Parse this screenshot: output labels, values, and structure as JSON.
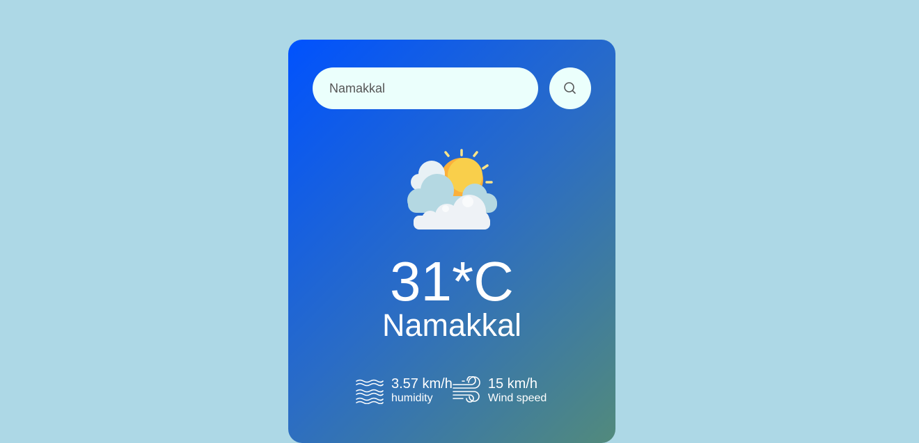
{
  "search": {
    "value": "Namakkal",
    "button_icon": "search-icon"
  },
  "weather": {
    "icon": "partly-cloudy-sun-icon",
    "temperature": "31*C",
    "city": "Namakkal"
  },
  "details": {
    "humidity": {
      "icon": "humidity-waves-icon",
      "value": "3.57 km/h",
      "label": "humidity"
    },
    "wind": {
      "icon": "wind-icon",
      "value": "15 km/h",
      "label": "Wind speed"
    }
  },
  "colors": {
    "page_background": "#add8e6",
    "card_gradient_start": "#0052fe",
    "card_gradient_end": "#528a7c",
    "input_background": "#ebfffc",
    "text": "#ffffff"
  }
}
